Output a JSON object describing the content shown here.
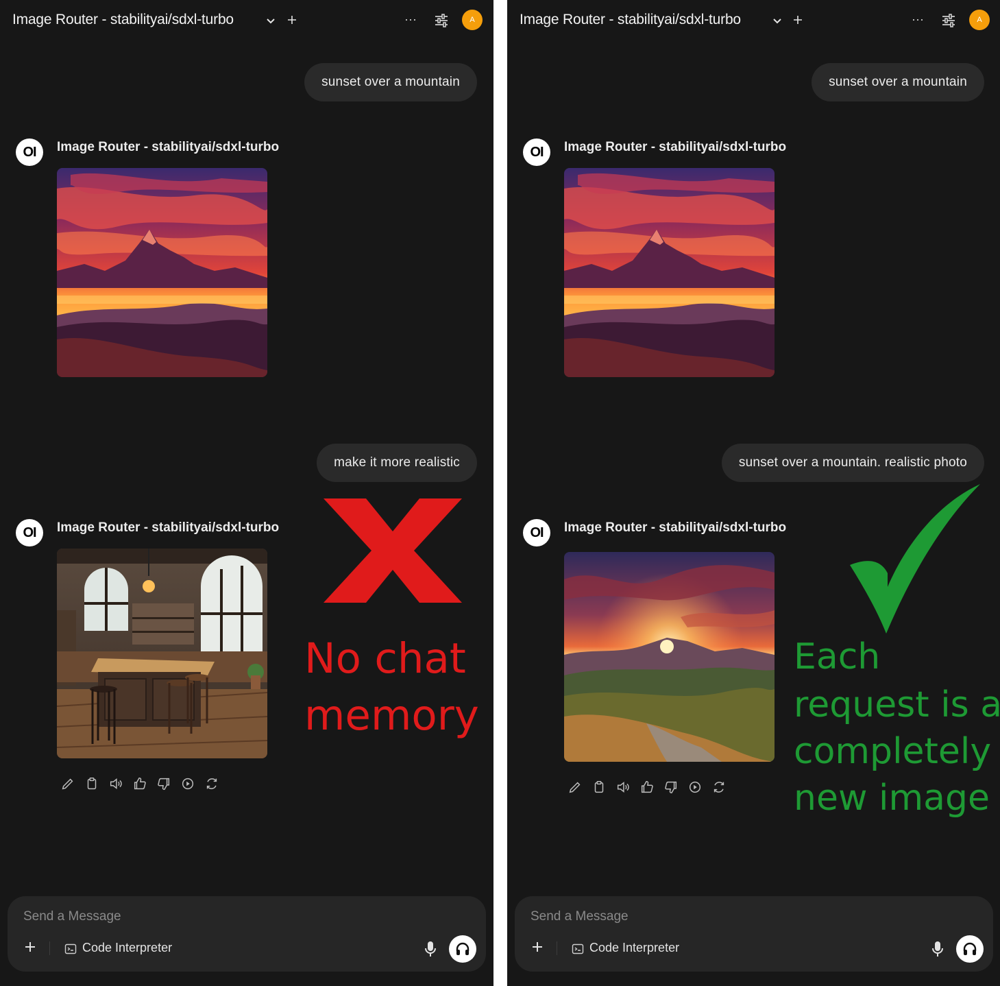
{
  "colors": {
    "background": "#171717",
    "bubble": "#2a2a2a",
    "avatar": "#f59e0b",
    "cross_red": "#e01b1b",
    "check_green": "#1e9a34"
  },
  "left": {
    "header": {
      "title": "Image Router - stabilityai/sdxl-turbo",
      "avatar_initial": "A",
      "more": "···"
    },
    "messages": [
      {
        "role": "user",
        "text": "sunset over a mountain"
      },
      {
        "role": "assistant",
        "avatar_text": "OI",
        "name": "Image Router - stabilityai/sdxl-turbo",
        "image": "mountain-sunset-illustration"
      },
      {
        "role": "user",
        "text": "make it more realistic"
      },
      {
        "role": "assistant",
        "avatar_text": "OI",
        "name": "Image Router - stabilityai/sdxl-turbo",
        "image": "kitchen-interior"
      }
    ],
    "annotation": {
      "icon": "cross-mark-icon",
      "line1": "No chat",
      "line2": "memory"
    },
    "composer": {
      "placeholder": "Send a Message",
      "tool": "Code Interpreter"
    }
  },
  "right": {
    "header": {
      "title": "Image Router - stabilityai/sdxl-turbo",
      "avatar_initial": "A",
      "more": "···"
    },
    "messages": [
      {
        "role": "user",
        "text": "sunset over a mountain"
      },
      {
        "role": "assistant",
        "avatar_text": "OI",
        "name": "Image Router - stabilityai/sdxl-turbo",
        "image": "mountain-sunset-illustration"
      },
      {
        "role": "user",
        "text": "sunset over a mountain. realistic photo"
      },
      {
        "role": "assistant",
        "avatar_text": "OI",
        "name": "Image Router - stabilityai/sdxl-turbo",
        "image": "realistic-mountain-sunset-photo"
      }
    ],
    "annotation": {
      "icon": "check-mark-icon",
      "line1": "Each",
      "line2": "request is a",
      "line3": "completely",
      "line4": "new image"
    },
    "composer": {
      "placeholder": "Send a Message",
      "tool": "Code Interpreter"
    }
  },
  "action_icons": [
    "edit-icon",
    "copy-icon",
    "read-aloud-icon",
    "thumbs-up-icon",
    "thumbs-down-icon",
    "continue-icon",
    "regenerate-icon"
  ]
}
